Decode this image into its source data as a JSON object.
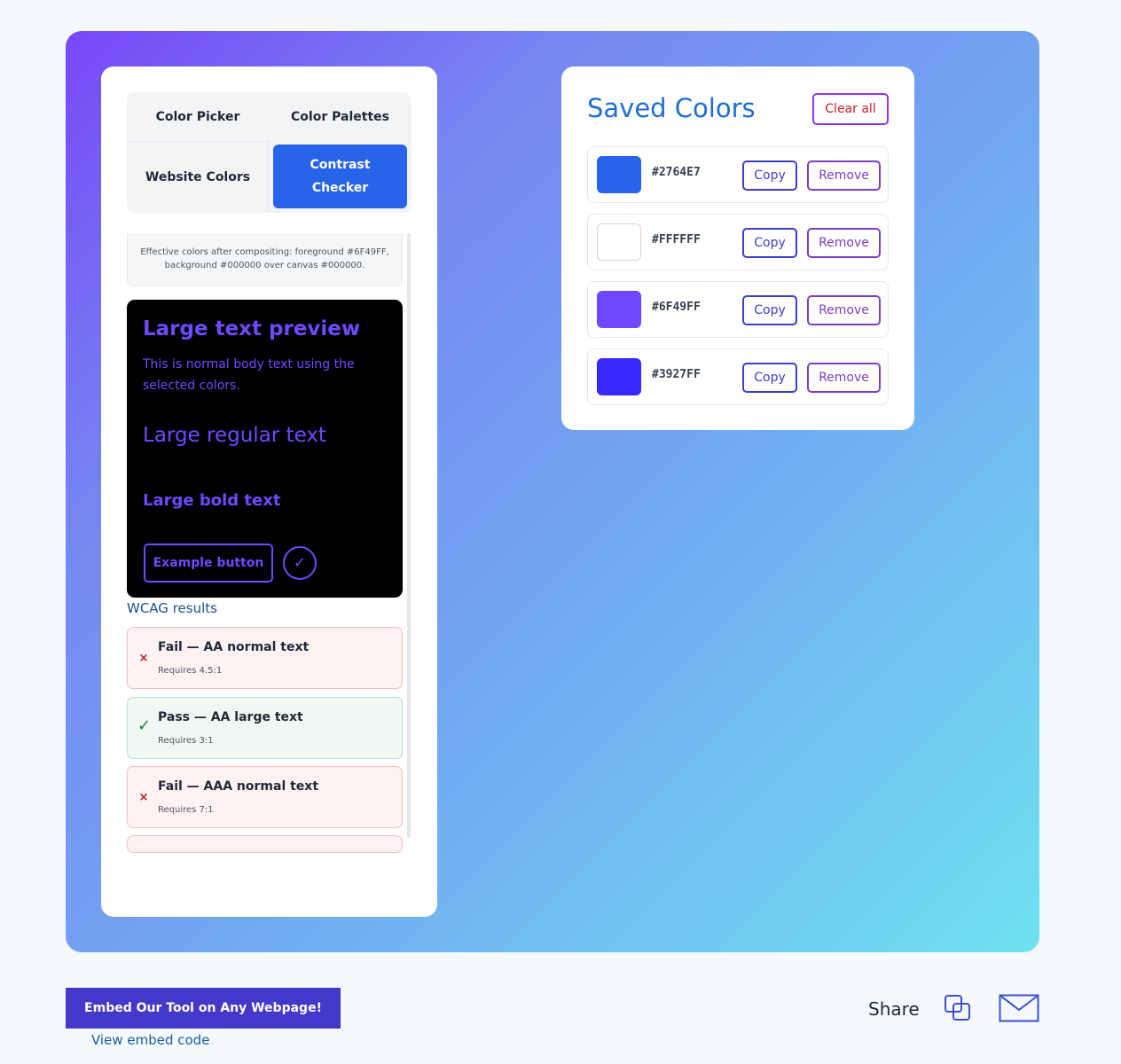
{
  "tabs": {
    "color_picker": "Color Picker",
    "color_palettes": "Color Palettes",
    "website_colors": "Website Colors",
    "contrast_checker": "Contrast Checker"
  },
  "note": "Effective colors after compositing: foreground #6F49FF, background #000000 over canvas #000000.",
  "preview": {
    "title": "Large text preview",
    "body": "This is normal body text using the selected colors.",
    "large_regular": "Large regular text",
    "large_bold": "Large bold text",
    "button": "Example button",
    "check_glyph": "✓",
    "foreground": "#6F49FF",
    "background": "#000000"
  },
  "wcag": {
    "title": "WCAG results",
    "results": [
      {
        "status": "fail",
        "icon": "×",
        "title": "Fail — AA normal text",
        "requirement": "Requires 4.5:1"
      },
      {
        "status": "pass",
        "icon": "✓",
        "title": "Pass — AA large text",
        "requirement": "Requires 3:1"
      },
      {
        "status": "fail",
        "icon": "×",
        "title": "Fail — AAA normal text",
        "requirement": "Requires 7:1"
      }
    ]
  },
  "saved": {
    "title": "Saved Colors",
    "clear_all": "Clear all",
    "copy_label": "Copy",
    "remove_label": "Remove",
    "colors": [
      {
        "hex": "#2764E7"
      },
      {
        "hex": "#FFFFFF"
      },
      {
        "hex": "#6F49FF"
      },
      {
        "hex": "#3927FF"
      }
    ]
  },
  "footer": {
    "embed_button": "Embed Our Tool on Any Webpage!",
    "embed_link": "View embed code",
    "share_label": "Share",
    "copy_icon": "copy-icon",
    "mail_icon": "mail-icon"
  }
}
